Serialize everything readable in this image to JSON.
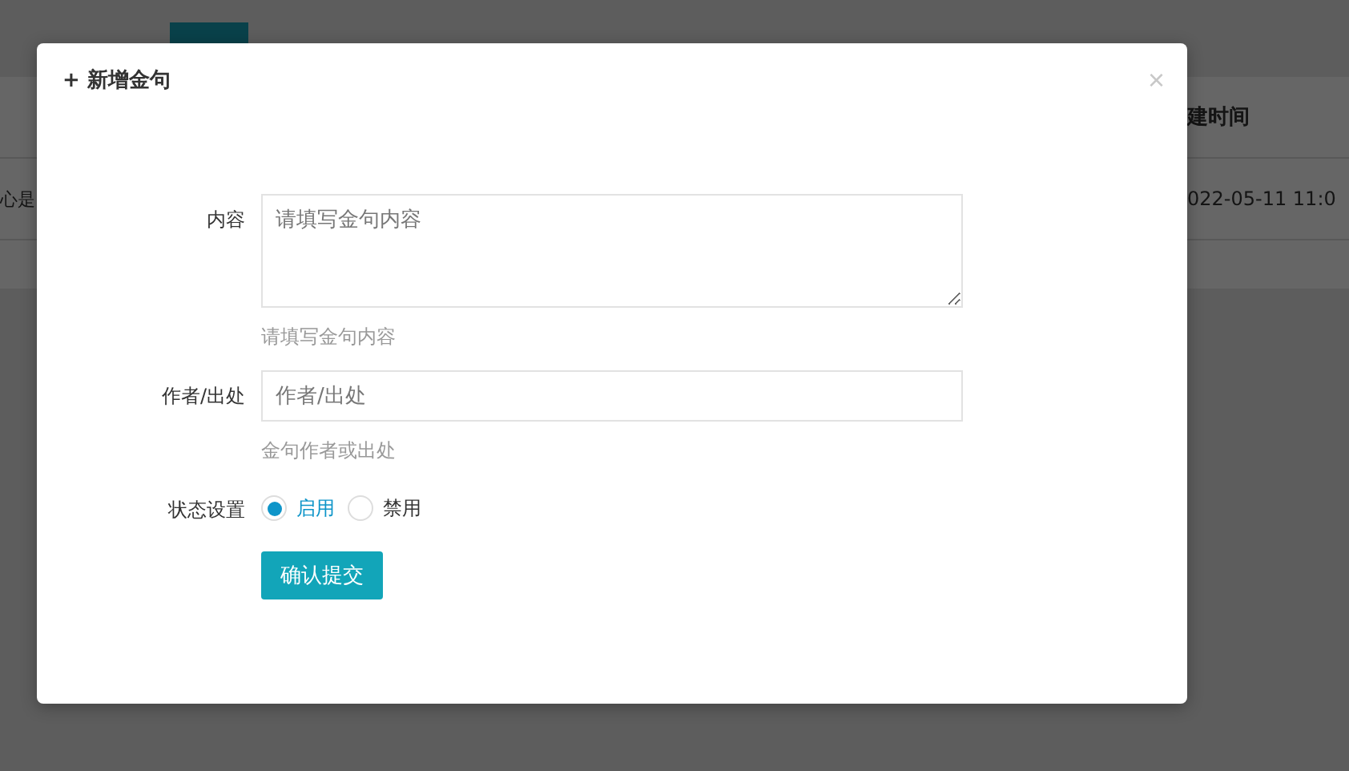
{
  "background": {
    "table": {
      "header": "建时间",
      "row": {
        "column_1": "心是",
        "column_2": "022-05-11 11:0"
      }
    }
  },
  "dialog": {
    "title": "+ 新增金句",
    "close": "×",
    "fields": [
      {
        "kind": "textarea",
        "label": "内容",
        "placeholder": "请填写金句内容",
        "hint": "请填写金句内容"
      },
      {
        "kind": "input",
        "label": "作者/出处",
        "placeholder": "作者/出处",
        "hint": "金句作者或出处"
      },
      {
        "kind": "radio",
        "label": "状态设置",
        "options": [
          {
            "label": "启用",
            "selected": true
          },
          {
            "label": "禁用",
            "selected": false
          }
        ]
      }
    ],
    "submit": "确认提交"
  }
}
